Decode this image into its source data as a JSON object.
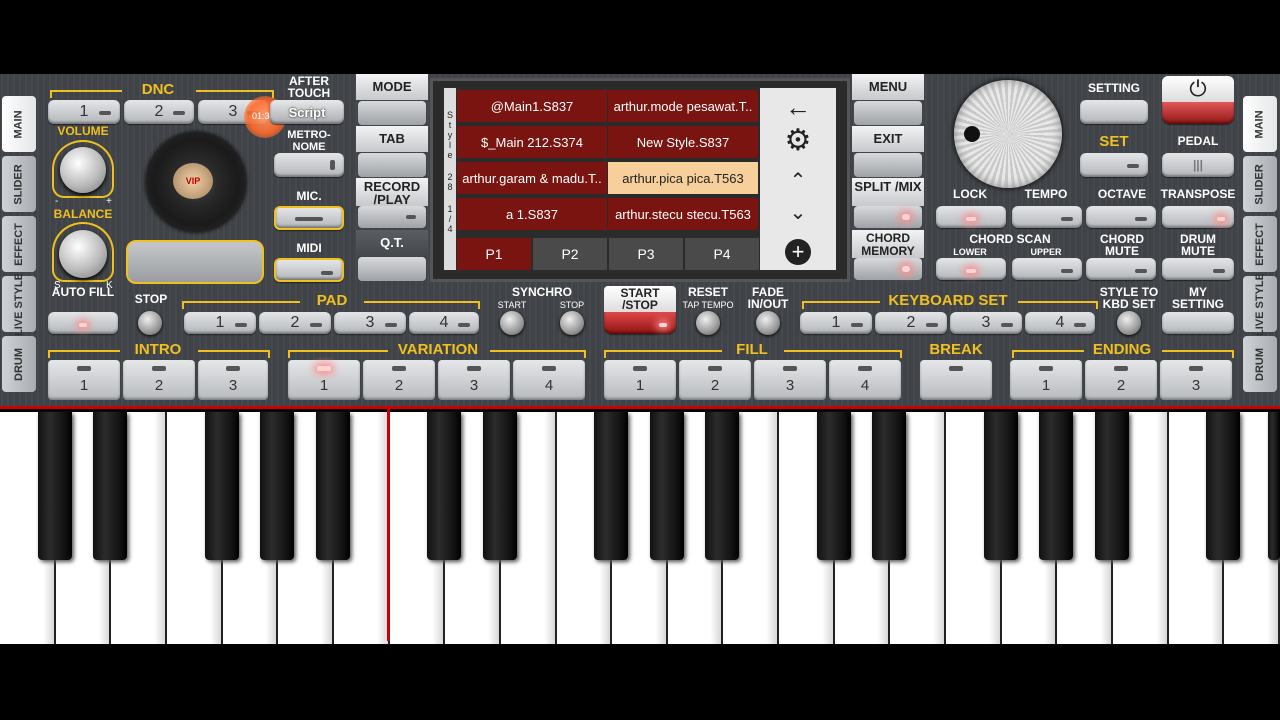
{
  "side_tabs_left": [
    "MAIN",
    "SLIDER",
    "EFFECT",
    "LIVE STYLE",
    "DRUM"
  ],
  "side_tabs_right": [
    "MAIN",
    "SLIDER",
    "EFFECT",
    "LIVE STYLE",
    "DRUM"
  ],
  "dnc": {
    "label": "DNC",
    "buttons": [
      "1",
      "2",
      "3"
    ]
  },
  "after_touch": {
    "label": "AFTER TOUCH",
    "script_button": "Script",
    "timer": "01:34"
  },
  "volume": "VOLUME",
  "balance": {
    "label": "BALANCE",
    "minus": "-",
    "plus": "+",
    "s": "S",
    "k": "K"
  },
  "vip": "VIP",
  "metronome": "METRO-NOME",
  "mic": "MIC.",
  "midi": "MIDI",
  "left_column": {
    "mode": "MODE",
    "tab": "TAB",
    "record": "RECORD /PLAY",
    "qt": "Q.T."
  },
  "style_list": {
    "side_label": [
      "S",
      "t",
      "y",
      "l",
      "e",
      "",
      "2",
      "8",
      "",
      "1",
      "/",
      "4"
    ],
    "cells": [
      "@Main1.S837",
      "arthur.mode pesawat.T..",
      "$_Main 212.S374",
      "New Style.S837",
      "arthur.garam & madu.T..",
      "arthur.pica pica.T563",
      "a 1.S837",
      "arthur.stecu stecu.T563"
    ],
    "pages": [
      "P1",
      "P2",
      "P3",
      "P4"
    ]
  },
  "right_column": {
    "menu": "MENU",
    "exit": "EXIT",
    "split": "SPLIT /MIX",
    "chord_memory": "CHORD MEMORY"
  },
  "setting": "SETTING",
  "set": "SET",
  "pedal": "PEDAL",
  "row_labels": {
    "lock": "LOCK",
    "tempo": "TEMPO",
    "octave": "OCTAVE",
    "transpose": "TRANSPOSE",
    "chord_scan": "CHORD SCAN",
    "lower": "LOWER",
    "upper": "UPPER",
    "chord_mute": "CHORD MUTE",
    "drum_mute": "DRUM MUTE"
  },
  "middle_row": {
    "auto_fill": "AUTO FILL",
    "stop": "STOP",
    "pad": "PAD",
    "pad_buttons": [
      "1",
      "2",
      "3",
      "4"
    ],
    "synchro": "SYNCHRO",
    "sync_start": "START",
    "sync_stop": "STOP",
    "start_stop": "START /STOP",
    "reset": "RESET",
    "tap_tempo": "TAP TEMPO",
    "fade": "FADE IN/OUT",
    "keyboard_set": "KEYBOARD SET",
    "kbd_buttons": [
      "1",
      "2",
      "3",
      "4"
    ],
    "style_to_kbd": "STYLE TO KBD SET",
    "my_setting": "MY SETTING"
  },
  "sections": {
    "intro": {
      "label": "INTRO",
      "buttons": [
        "1",
        "2",
        "3"
      ]
    },
    "variation": {
      "label": "VARIATION",
      "buttons": [
        "1",
        "2",
        "3",
        "4"
      ]
    },
    "fill": {
      "label": "FILL",
      "buttons": [
        "1",
        "2",
        "3",
        "4"
      ]
    },
    "break": {
      "label": "BREAK"
    },
    "ending": {
      "label": "ENDING",
      "buttons": [
        "1",
        "2",
        "3"
      ]
    }
  },
  "icons": {
    "back": "arrow-left-icon",
    "settings": "gear-icon",
    "up": "chevron-up-icon",
    "down": "chevron-down-icon",
    "add": "plus-circle-icon",
    "power": "power-icon"
  }
}
